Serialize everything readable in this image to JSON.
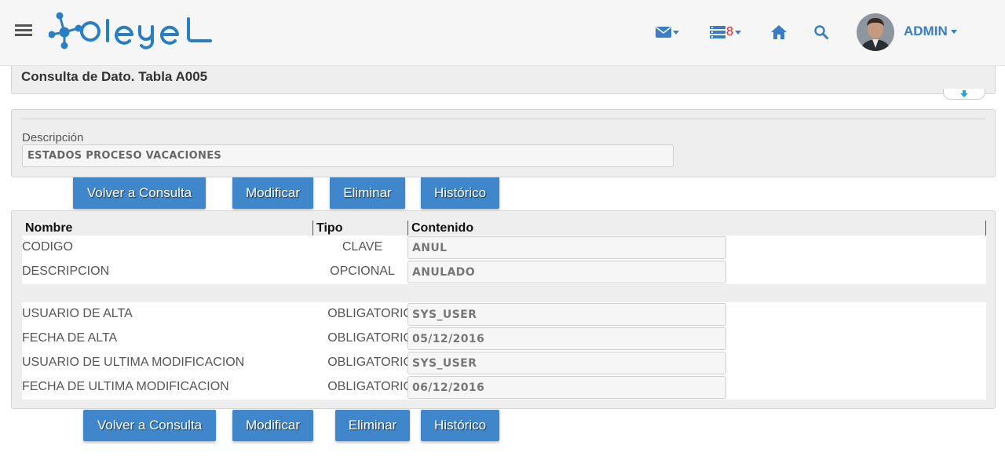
{
  "header": {
    "logo_text": "deyel",
    "tasks_count": "8",
    "user_label": "ADMIN"
  },
  "page": {
    "title": "Consulta de Dato. Tabla A005"
  },
  "description": {
    "label": "Descripción",
    "value": "ESTADOS PROCESO VACACIONES"
  },
  "buttons": {
    "back": "Volver a Consulta",
    "modify": "Modificar",
    "delete": "Eliminar",
    "history": "Histórico"
  },
  "table": {
    "headers": {
      "name": "Nombre",
      "type": "Tipo",
      "content": "Contenido"
    },
    "group1": [
      {
        "name": "CODIGO",
        "type": "CLAVE",
        "value": "ANUL"
      },
      {
        "name": "DESCRIPCION",
        "type": "OPCIONAL",
        "value": "ANULADO"
      }
    ],
    "group2": [
      {
        "name": "USUARIO DE ALTA",
        "type": "OBLIGATORIO",
        "value": "SYS_USER"
      },
      {
        "name": "FECHA DE ALTA",
        "type": "OBLIGATORIO",
        "value": "05/12/2016"
      },
      {
        "name": "USUARIO DE ULTIMA MODIFICACION",
        "type": "OBLIGATORIO",
        "value": "SYS_USER"
      },
      {
        "name": "FECHA DE ULTIMA MODIFICACION",
        "type": "OBLIGATORIO",
        "value": "06/12/2016"
      }
    ]
  },
  "icons": {
    "menu": "hamburger-menu-icon",
    "mail": "envelope-icon",
    "tasks": "task-list-icon",
    "home": "home-icon",
    "search": "search-icon",
    "collapse": "arrow-down-icon"
  },
  "colors": {
    "accent": "#3f86cb",
    "nav_icon": "#3a7dc4",
    "badge": "#e02020",
    "logo": "#2a7fc2"
  }
}
